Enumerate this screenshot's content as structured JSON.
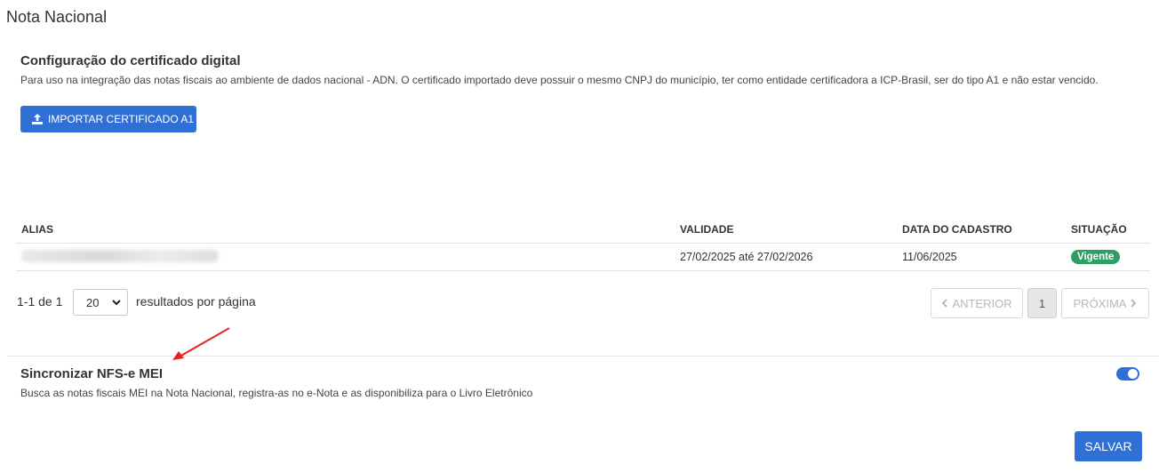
{
  "page": {
    "title": "Nota Nacional"
  },
  "certificate": {
    "title": "Configuração do certificado digital",
    "description": "Para uso na integração das notas fiscais ao ambiente de dados nacional - ADN. O certificado importado deve possuir o mesmo CNPJ do município, ter como entidade certificadora a ICP-Brasil, ser do tipo A1 e não estar vencido.",
    "import_button": "IMPORTAR CERTIFICADO A1",
    "import_icon": "upload-icon"
  },
  "table": {
    "headers": {
      "alias": "ALIAS",
      "validade": "VALIDADE",
      "cadastro": "DATA DO CADASTRO",
      "situacao": "SITUAÇÃO"
    },
    "rows": [
      {
        "validade": "27/02/2025 até 27/02/2026",
        "cadastro": "11/06/2025",
        "situacao": "Vigente"
      }
    ],
    "status_color": "#2e9e63"
  },
  "pagination": {
    "range_text": "1-1 de 1",
    "per_page": "20",
    "per_page_label": "resultados por página",
    "prev": "ANTERIOR",
    "current": "1",
    "next": "PRÓXIMA"
  },
  "sync": {
    "title": "Sincronizar NFS-e MEI",
    "description": "Busca as notas fiscais MEI na Nota Nacional, registra-as no e-Nota e as disponibiliza para o Livro Eletrônico",
    "enabled": true
  },
  "actions": {
    "save": "SALVAR"
  },
  "colors": {
    "primary": "#2f6fd6",
    "annotation_arrow": "#e8201e"
  }
}
